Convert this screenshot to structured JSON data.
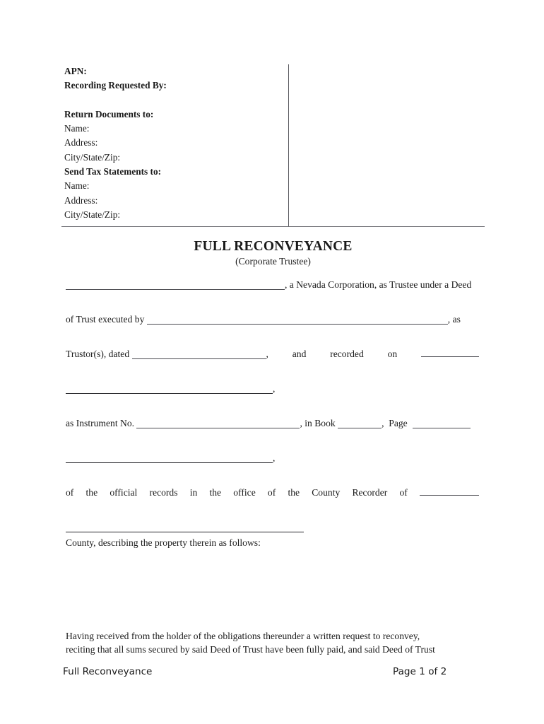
{
  "document": {
    "title": "FULL RECONVEYANCE",
    "subtitle": "(Corporate Trustee)"
  },
  "recording_header": {
    "apn_label": "APN:",
    "recording_requested_by_label": "Recording Requested By:",
    "return_documents_label": "Return Documents to:",
    "return_name_label": "Name:",
    "return_address_label": "Address:",
    "return_city_state_zip_label": "City/State/Zip:",
    "send_tax_statements_label": "Send Tax Statements to:",
    "tax_name_label": "Name:",
    "tax_address_label": "Address:",
    "tax_city_state_zip_label": "City/State/Zip:"
  },
  "body": {
    "line1_after_blank": ", a Nevada Corporation, as Trustee under a Deed",
    "line2_prefix": "of Trust executed by",
    "line2_suffix": ", as",
    "line3_prefix": "Trustor(s), dated",
    "line3_comma": ",",
    "line3_word_and": "and",
    "line3_word_recorded": "recorded",
    "line3_word_on": "on",
    "line4_comma": ",",
    "line5_prefix": "as Instrument No.",
    "line5_mid": ", in Book",
    "line5_comma": ",",
    "line5_page": "Page",
    "line6_comma": ",",
    "line7_w1": "of",
    "line7_w2": "the",
    "line7_w3": "official",
    "line7_w4": "records",
    "line7_w5": "in",
    "line7_w6": "the",
    "line7_w7": "office",
    "line7_w8": "of",
    "line7_w9": "the",
    "line7_w10": "County",
    "line7_w11": "Recorder",
    "line7_w12": "of",
    "line9": "County, describing the property therein as follows:"
  },
  "closing": {
    "line1": "Having received from the holder of the obligations thereunder a written request to reconvey,",
    "line2": "reciting that all sums secured by said Deed of Trust have been fully paid, and said Deed of Trust"
  },
  "footer": {
    "document_name": "Full Reconveyance",
    "page_indicator": "Page 1 of 2"
  }
}
